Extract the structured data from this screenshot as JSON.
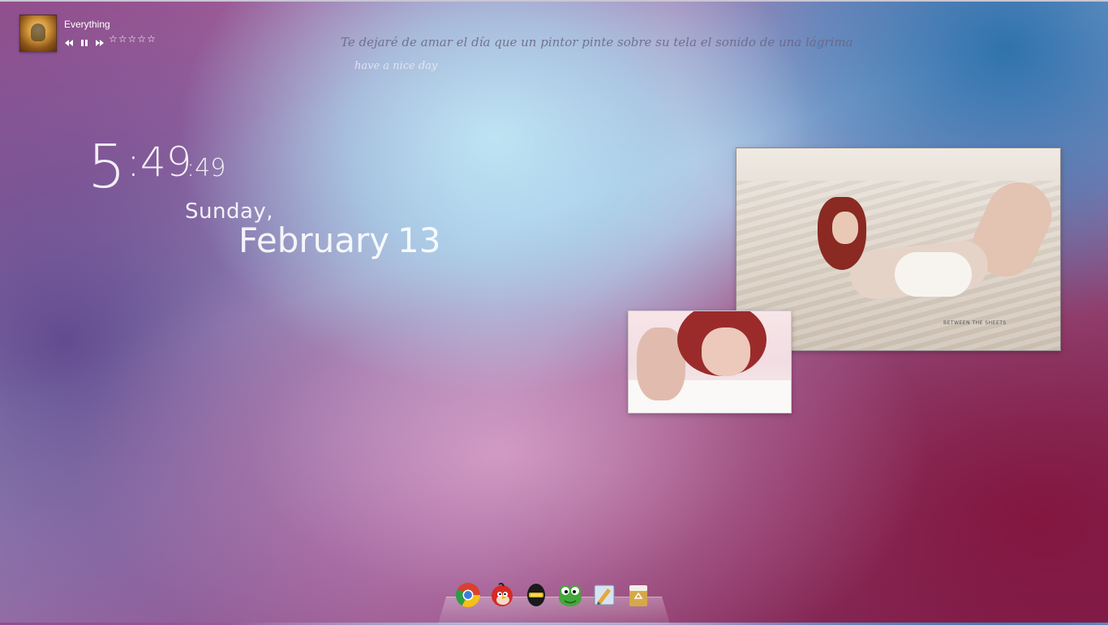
{
  "music_widget": {
    "track_title": "Everything",
    "rating_stars": [
      "☆",
      "☆",
      "☆",
      "☆",
      "☆"
    ],
    "controls": [
      "previous-icon",
      "pause-icon",
      "next-icon"
    ]
  },
  "quote": {
    "text": "Te dejaré de amar el día que un pintor pinte sobre su tela el sonido de una lágrima",
    "subtitle": "have a nice day"
  },
  "clock": {
    "hour": "5",
    "minutes": ":49",
    "seconds": ":49",
    "weekday": "Sunday,",
    "month": "February",
    "day": "13"
  },
  "photos": {
    "large_watermark": "BETWEEN THE SHEETS"
  },
  "dock": {
    "items": [
      "chrome-icon",
      "angry-bird-icon",
      "daft-punk-icon",
      "frog-icon",
      "paint-icon",
      "recycle-bin-icon"
    ]
  },
  "colors": {
    "text": "#ffffff",
    "quote": "#69648a"
  }
}
